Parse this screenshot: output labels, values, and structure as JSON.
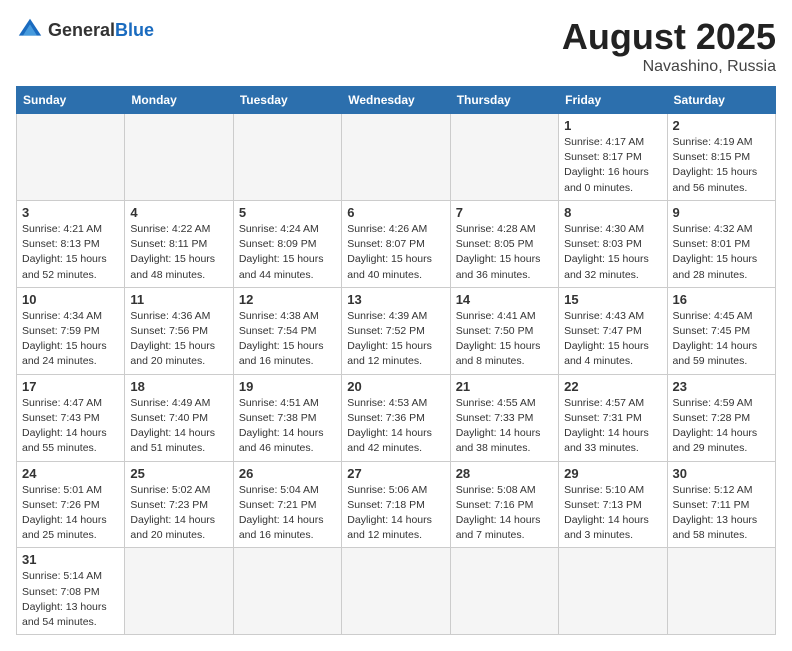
{
  "header": {
    "logo_general": "General",
    "logo_blue": "Blue",
    "month_year": "August 2025",
    "location": "Navashino, Russia"
  },
  "days_of_week": [
    "Sunday",
    "Monday",
    "Tuesday",
    "Wednesday",
    "Thursday",
    "Friday",
    "Saturday"
  ],
  "weeks": [
    [
      {
        "day": null,
        "info": null
      },
      {
        "day": null,
        "info": null
      },
      {
        "day": null,
        "info": null
      },
      {
        "day": null,
        "info": null
      },
      {
        "day": null,
        "info": null
      },
      {
        "day": "1",
        "info": "Sunrise: 4:17 AM\nSunset: 8:17 PM\nDaylight: 16 hours and 0 minutes."
      },
      {
        "day": "2",
        "info": "Sunrise: 4:19 AM\nSunset: 8:15 PM\nDaylight: 15 hours and 56 minutes."
      }
    ],
    [
      {
        "day": "3",
        "info": "Sunrise: 4:21 AM\nSunset: 8:13 PM\nDaylight: 15 hours and 52 minutes."
      },
      {
        "day": "4",
        "info": "Sunrise: 4:22 AM\nSunset: 8:11 PM\nDaylight: 15 hours and 48 minutes."
      },
      {
        "day": "5",
        "info": "Sunrise: 4:24 AM\nSunset: 8:09 PM\nDaylight: 15 hours and 44 minutes."
      },
      {
        "day": "6",
        "info": "Sunrise: 4:26 AM\nSunset: 8:07 PM\nDaylight: 15 hours and 40 minutes."
      },
      {
        "day": "7",
        "info": "Sunrise: 4:28 AM\nSunset: 8:05 PM\nDaylight: 15 hours and 36 minutes."
      },
      {
        "day": "8",
        "info": "Sunrise: 4:30 AM\nSunset: 8:03 PM\nDaylight: 15 hours and 32 minutes."
      },
      {
        "day": "9",
        "info": "Sunrise: 4:32 AM\nSunset: 8:01 PM\nDaylight: 15 hours and 28 minutes."
      }
    ],
    [
      {
        "day": "10",
        "info": "Sunrise: 4:34 AM\nSunset: 7:59 PM\nDaylight: 15 hours and 24 minutes."
      },
      {
        "day": "11",
        "info": "Sunrise: 4:36 AM\nSunset: 7:56 PM\nDaylight: 15 hours and 20 minutes."
      },
      {
        "day": "12",
        "info": "Sunrise: 4:38 AM\nSunset: 7:54 PM\nDaylight: 15 hours and 16 minutes."
      },
      {
        "day": "13",
        "info": "Sunrise: 4:39 AM\nSunset: 7:52 PM\nDaylight: 15 hours and 12 minutes."
      },
      {
        "day": "14",
        "info": "Sunrise: 4:41 AM\nSunset: 7:50 PM\nDaylight: 15 hours and 8 minutes."
      },
      {
        "day": "15",
        "info": "Sunrise: 4:43 AM\nSunset: 7:47 PM\nDaylight: 15 hours and 4 minutes."
      },
      {
        "day": "16",
        "info": "Sunrise: 4:45 AM\nSunset: 7:45 PM\nDaylight: 14 hours and 59 minutes."
      }
    ],
    [
      {
        "day": "17",
        "info": "Sunrise: 4:47 AM\nSunset: 7:43 PM\nDaylight: 14 hours and 55 minutes."
      },
      {
        "day": "18",
        "info": "Sunrise: 4:49 AM\nSunset: 7:40 PM\nDaylight: 14 hours and 51 minutes."
      },
      {
        "day": "19",
        "info": "Sunrise: 4:51 AM\nSunset: 7:38 PM\nDaylight: 14 hours and 46 minutes."
      },
      {
        "day": "20",
        "info": "Sunrise: 4:53 AM\nSunset: 7:36 PM\nDaylight: 14 hours and 42 minutes."
      },
      {
        "day": "21",
        "info": "Sunrise: 4:55 AM\nSunset: 7:33 PM\nDaylight: 14 hours and 38 minutes."
      },
      {
        "day": "22",
        "info": "Sunrise: 4:57 AM\nSunset: 7:31 PM\nDaylight: 14 hours and 33 minutes."
      },
      {
        "day": "23",
        "info": "Sunrise: 4:59 AM\nSunset: 7:28 PM\nDaylight: 14 hours and 29 minutes."
      }
    ],
    [
      {
        "day": "24",
        "info": "Sunrise: 5:01 AM\nSunset: 7:26 PM\nDaylight: 14 hours and 25 minutes."
      },
      {
        "day": "25",
        "info": "Sunrise: 5:02 AM\nSunset: 7:23 PM\nDaylight: 14 hours and 20 minutes."
      },
      {
        "day": "26",
        "info": "Sunrise: 5:04 AM\nSunset: 7:21 PM\nDaylight: 14 hours and 16 minutes."
      },
      {
        "day": "27",
        "info": "Sunrise: 5:06 AM\nSunset: 7:18 PM\nDaylight: 14 hours and 12 minutes."
      },
      {
        "day": "28",
        "info": "Sunrise: 5:08 AM\nSunset: 7:16 PM\nDaylight: 14 hours and 7 minutes."
      },
      {
        "day": "29",
        "info": "Sunrise: 5:10 AM\nSunset: 7:13 PM\nDaylight: 14 hours and 3 minutes."
      },
      {
        "day": "30",
        "info": "Sunrise: 5:12 AM\nSunset: 7:11 PM\nDaylight: 13 hours and 58 minutes."
      }
    ],
    [
      {
        "day": "31",
        "info": "Sunrise: 5:14 AM\nSunset: 7:08 PM\nDaylight: 13 hours and 54 minutes."
      },
      {
        "day": null,
        "info": null
      },
      {
        "day": null,
        "info": null
      },
      {
        "day": null,
        "info": null
      },
      {
        "day": null,
        "info": null
      },
      {
        "day": null,
        "info": null
      },
      {
        "day": null,
        "info": null
      }
    ]
  ]
}
